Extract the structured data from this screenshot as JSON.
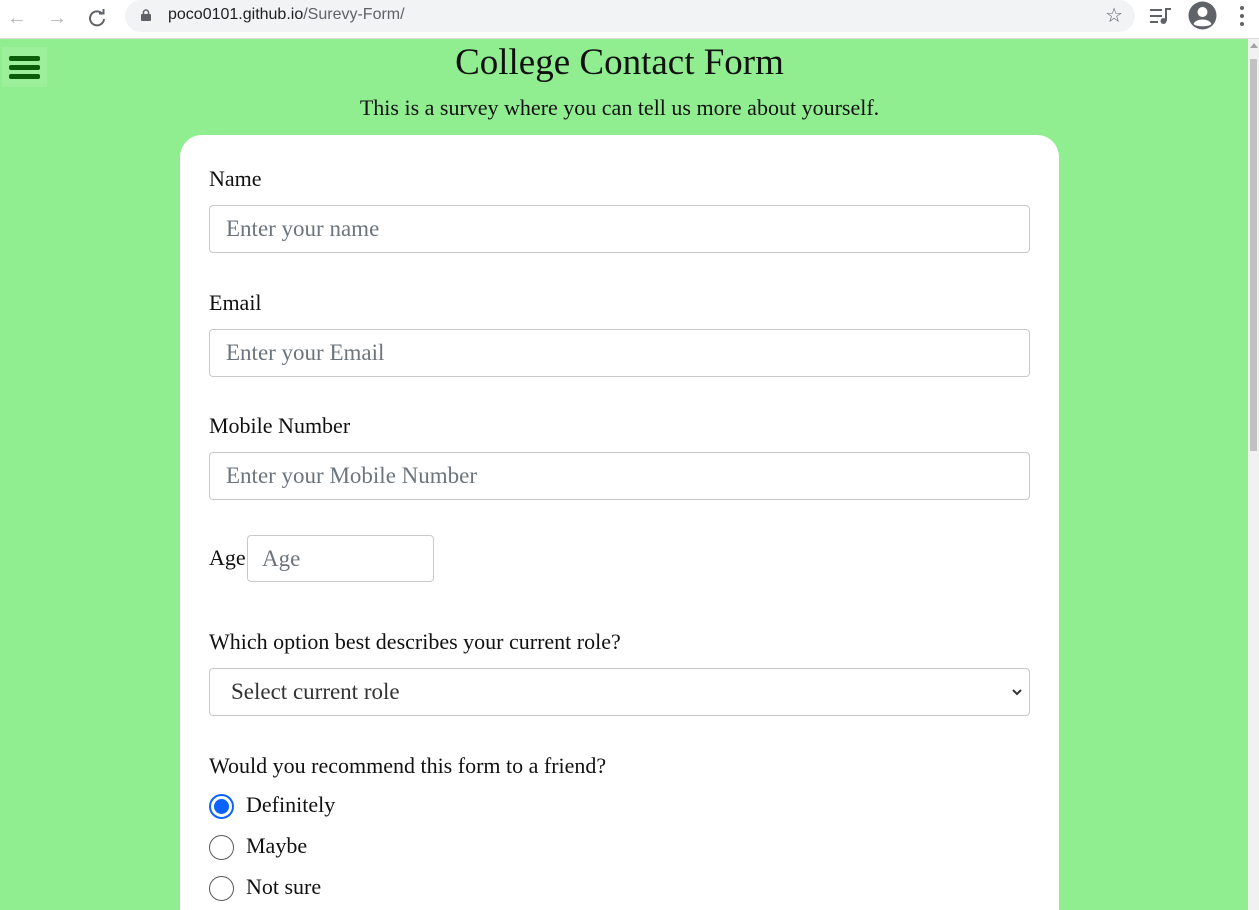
{
  "browser": {
    "url_host": "poco0101.github.io",
    "url_path": "/Surevy-Form/"
  },
  "page": {
    "title": "College Contact Form",
    "description": "This is a survey where you can tell us more about yourself.",
    "background_color": "#90ee90"
  },
  "form": {
    "name": {
      "label": "Name",
      "placeholder": "Enter your name",
      "value": ""
    },
    "email": {
      "label": "Email",
      "placeholder": "Enter your Email",
      "value": ""
    },
    "mobile": {
      "label": "Mobile Number",
      "placeholder": "Enter your Mobile Number",
      "value": ""
    },
    "age": {
      "label": "Age",
      "placeholder": "Age",
      "value": ""
    },
    "role": {
      "question": "Which option best describes your current role?",
      "selected": "Select current role"
    },
    "recommend": {
      "question": "Would you recommend this form to a friend?",
      "options": [
        {
          "label": "Definitely",
          "checked": true
        },
        {
          "label": "Maybe",
          "checked": false
        },
        {
          "label": "Not sure",
          "checked": false
        }
      ]
    }
  },
  "icons": {
    "back": "back-arrow-icon",
    "forward": "forward-arrow-icon",
    "reload": "reload-icon",
    "lock": "lock-icon",
    "bookmark": "star-icon",
    "media": "media-control-icon",
    "profile": "profile-icon",
    "menu": "more-vert-icon",
    "nav": "hamburger-menu-icon"
  },
  "colors": {
    "accent": "#0b63ff",
    "hamburger": "#0b5d0b"
  }
}
